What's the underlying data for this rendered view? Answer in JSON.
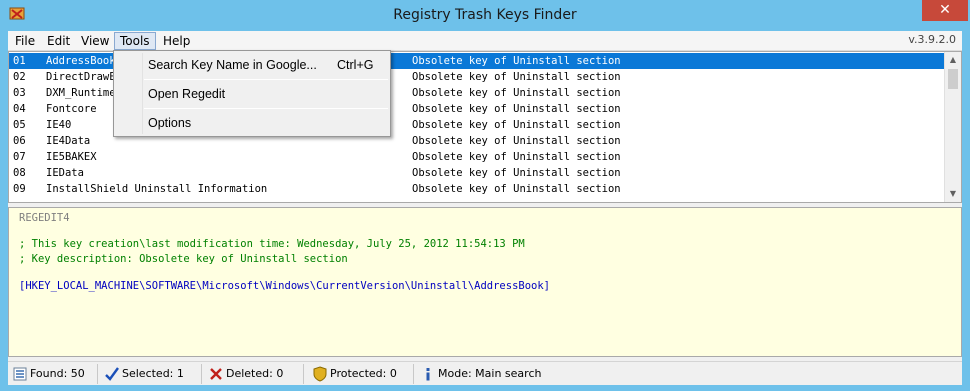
{
  "window": {
    "title": "Registry Trash Keys Finder",
    "close_symbol": "✕"
  },
  "menu": {
    "items": [
      "File",
      "Edit",
      "View",
      "Tools",
      "Help"
    ],
    "open_menu": "Tools",
    "version": "v.3.9.2.0"
  },
  "tools_menu": {
    "items": [
      {
        "label": "Search Key Name in Google...",
        "shortcut": "Ctrl+G"
      },
      {
        "label": "Open Regedit",
        "shortcut": ""
      },
      {
        "label": "Options",
        "shortcut": ""
      }
    ]
  },
  "keys": [
    {
      "num": "01",
      "name": "AddressBook",
      "description": "Obsolete key of Uninstall section",
      "selected": true
    },
    {
      "num": "02",
      "name": "DirectDrawEx",
      "description": "Obsolete key of Uninstall section",
      "selected": false
    },
    {
      "num": "03",
      "name": "DXM_Runtime",
      "description": "Obsolete key of Uninstall section",
      "selected": false
    },
    {
      "num": "04",
      "name": "Fontcore",
      "description": "Obsolete key of Uninstall section",
      "selected": false
    },
    {
      "num": "05",
      "name": "IE40",
      "description": "Obsolete key of Uninstall section",
      "selected": false
    },
    {
      "num": "06",
      "name": "IE4Data",
      "description": "Obsolete key of Uninstall section",
      "selected": false
    },
    {
      "num": "07",
      "name": "IE5BAKEX",
      "description": "Obsolete key of Uninstall section",
      "selected": false
    },
    {
      "num": "08",
      "name": "IEData",
      "description": "Obsolete key of Uninstall section",
      "selected": false
    },
    {
      "num": "09",
      "name": "InstallShield Uninstall Information",
      "description": "Obsolete key of Uninstall section",
      "selected": false
    }
  ],
  "details": {
    "header": "REGEDIT4",
    "time_comment": "; This key creation\\last modification time: Wednesday, July 25, 2012 11:54:13 PM",
    "desc_comment": "; Key description: Obsolete key of Uninstall section",
    "key_path": "[HKEY_LOCAL_MACHINE\\SOFTWARE\\Microsoft\\Windows\\CurrentVersion\\Uninstall\\AddressBook]"
  },
  "status": {
    "found": "Found: 50",
    "selected": "Selected: 1",
    "deleted": "Deleted: 0",
    "protected": "Protected: 0",
    "mode": "Mode: Main search"
  },
  "colors": {
    "titlebar": "#6ec1ea",
    "close": "#c7493a",
    "selection": "#0a78d7",
    "detail_bg": "#ffffe1",
    "comment": "#008000",
    "key_path": "#0000c0"
  }
}
